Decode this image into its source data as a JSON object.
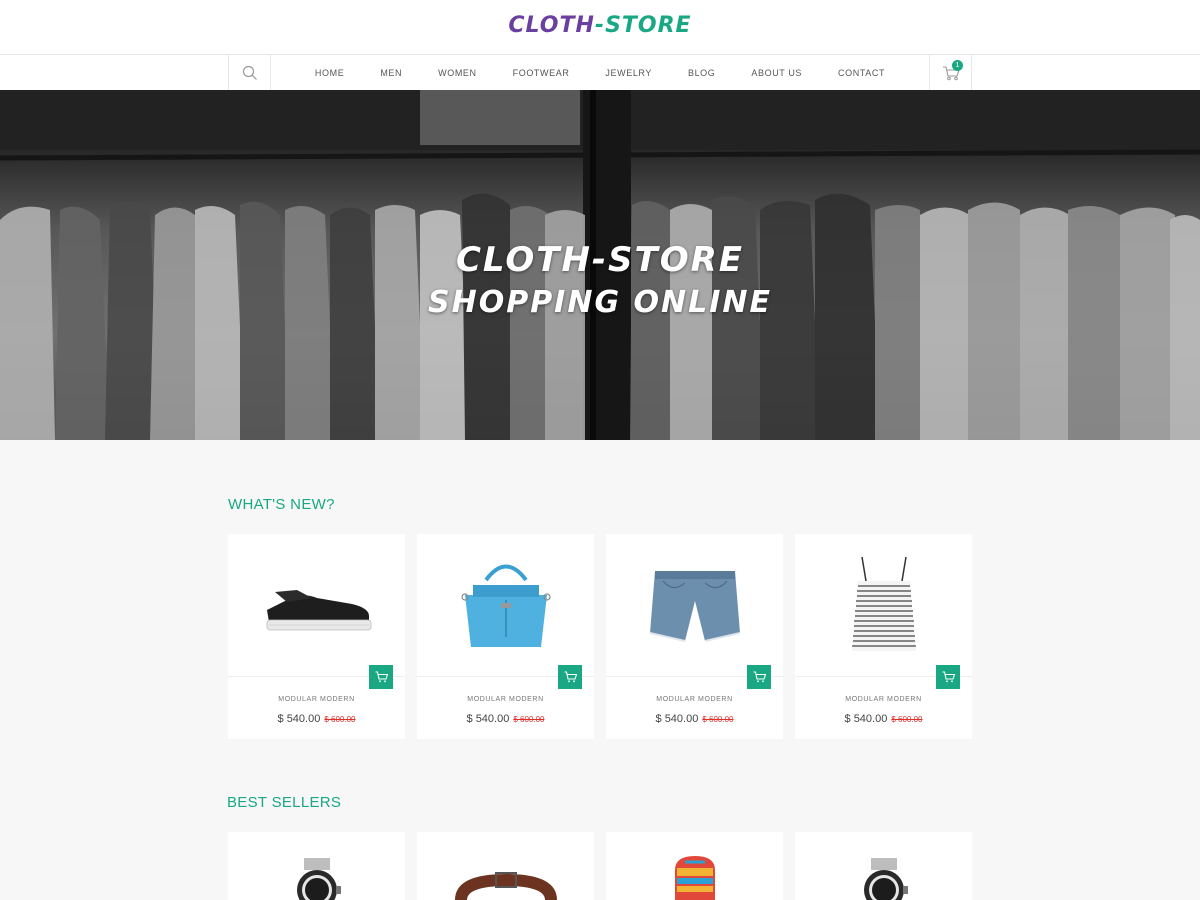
{
  "brand": {
    "part1": "CLOTH",
    "dash": "-",
    "part2": "STORE"
  },
  "nav": {
    "items": [
      "HOME",
      "MEN",
      "WOMEN",
      "FOOTWEAR",
      "JEWELRY",
      "BLOG",
      "ABOUT US",
      "CONTACT"
    ],
    "cart_count": "1"
  },
  "hero": {
    "line1": "CLOTH-STORE",
    "line2": "SHOPPING ONLINE"
  },
  "whats_new": {
    "title": "WHAT'S NEW?",
    "products": [
      {
        "icon": "sneaker-image",
        "name": "MODULAR MODERN",
        "price": "$ 540.00",
        "old_price": "$ 600.00"
      },
      {
        "icon": "handbag-image",
        "name": "MODULAR MODERN",
        "price": "$ 540.00",
        "old_price": "$ 600.00"
      },
      {
        "icon": "denim-shorts-image",
        "name": "MODULAR MODERN",
        "price": "$ 540.00",
        "old_price": "$ 600.00"
      },
      {
        "icon": "striped-top-image",
        "name": "MODULAR MODERN",
        "price": "$ 540.00",
        "old_price": "$ 600.00"
      }
    ]
  },
  "best_sellers": {
    "title": "BEST SELLERS",
    "products": [
      {
        "icon": "watch-image"
      },
      {
        "icon": "belt-image"
      },
      {
        "icon": "backpack-image"
      },
      {
        "icon": "watch-image"
      }
    ]
  },
  "colors": {
    "accent": "#19a883",
    "brand_purple": "#6a3fa0",
    "sale_red": "#e0302a"
  }
}
